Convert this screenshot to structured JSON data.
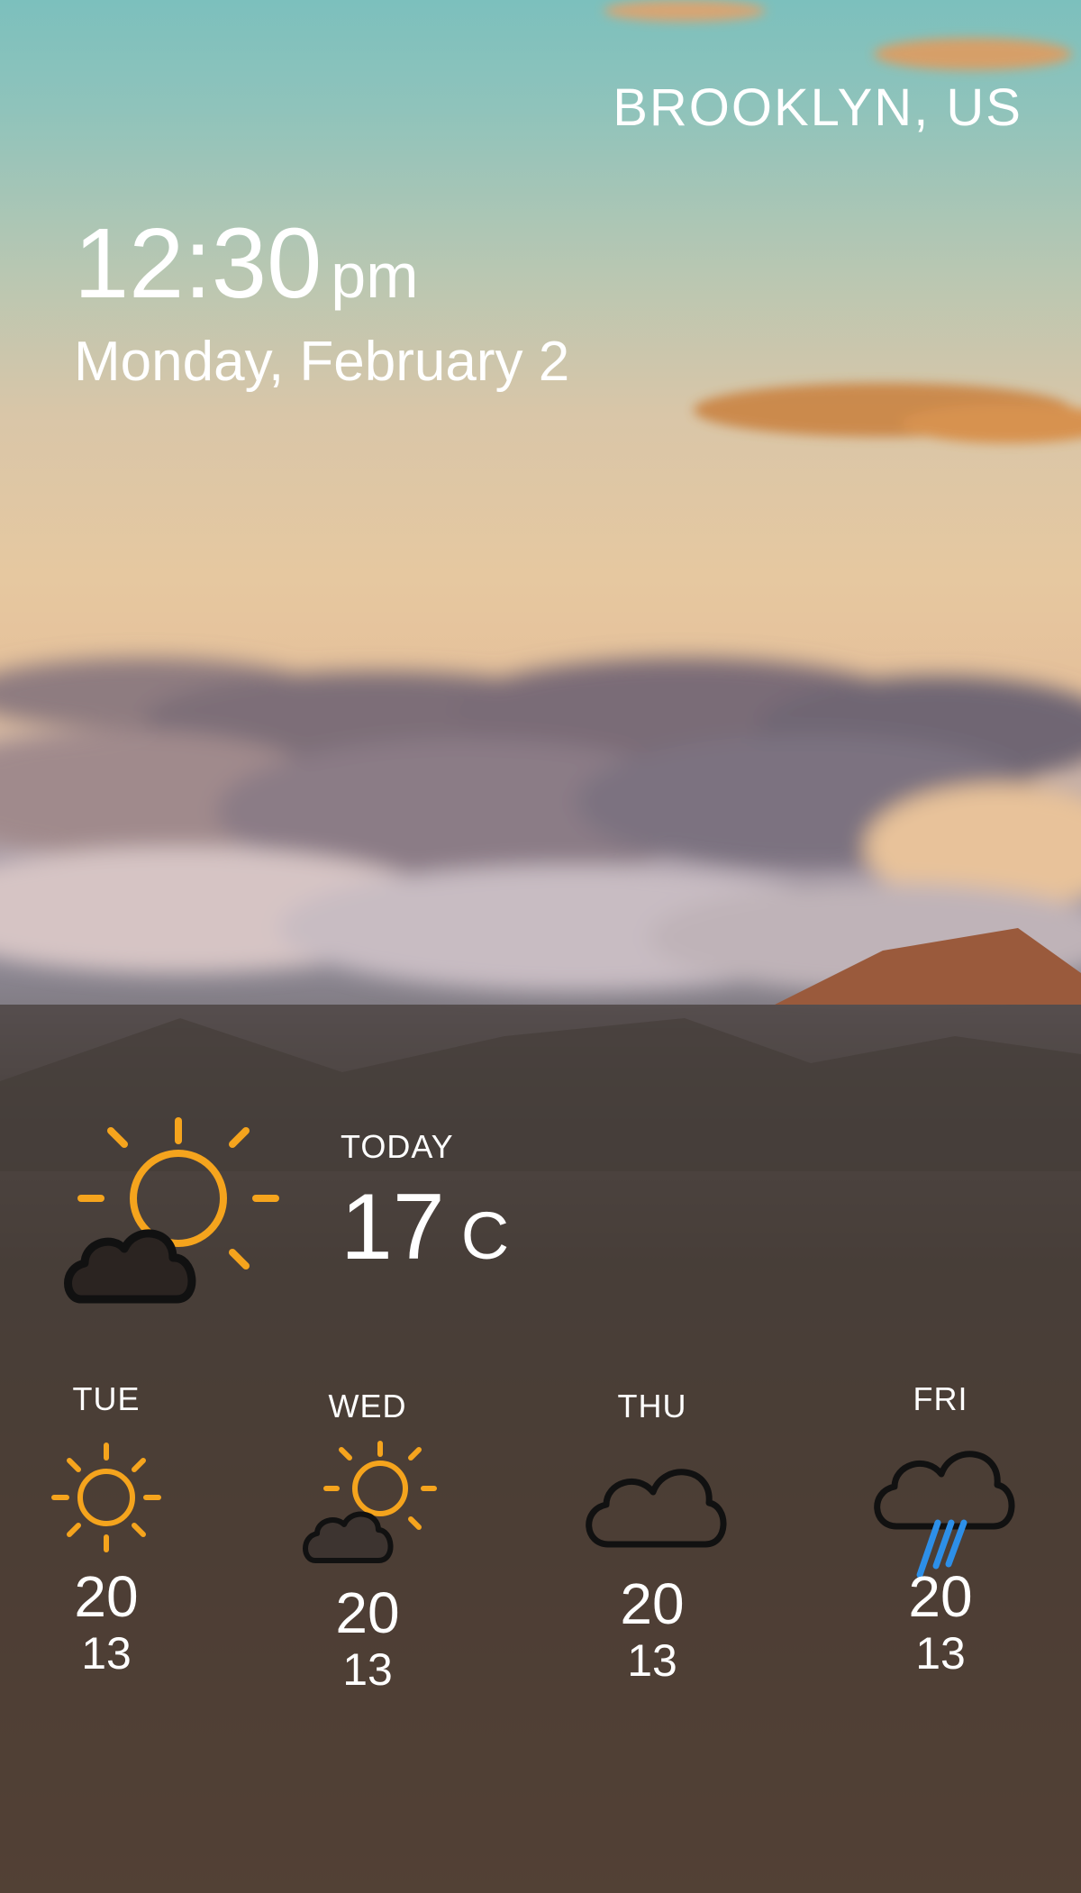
{
  "header": {
    "location": "BROOKLYN, US"
  },
  "clock": {
    "time": "12:30",
    "ampm": "pm",
    "date": "Monday, February 2"
  },
  "today": {
    "label": "TODAY",
    "temp": "17",
    "unit": "C",
    "icon": "partly-cloudy-icon"
  },
  "forecast": [
    {
      "day": "TUE",
      "high": "20",
      "low": "13",
      "icon": "sun-icon"
    },
    {
      "day": "WED",
      "high": "20",
      "low": "13",
      "icon": "partly-cloudy-icon"
    },
    {
      "day": "THU",
      "high": "20",
      "low": "13",
      "icon": "cloud-icon"
    },
    {
      "day": "FRI",
      "high": "20",
      "low": "13",
      "icon": "rain-cloud-icon"
    }
  ],
  "colors": {
    "sun": "#f5a41d",
    "rain": "#2d8fe8",
    "cloud_outline": "#111111",
    "panel": "#3a302c"
  }
}
